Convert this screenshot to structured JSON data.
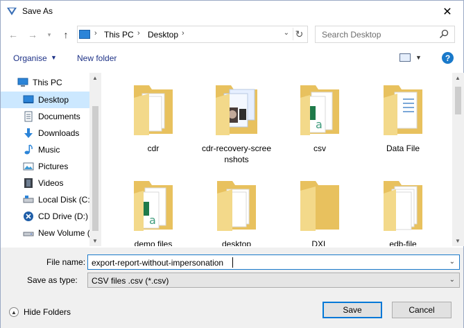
{
  "window": {
    "title": "Save As"
  },
  "address": {
    "crumbs": [
      "This PC",
      "Desktop"
    ]
  },
  "search": {
    "placeholder": "Search Desktop"
  },
  "toolbar": {
    "organise_label": "Organise",
    "new_folder_label": "New folder",
    "help_label": "?"
  },
  "sidebar": {
    "items": [
      {
        "label": "This PC",
        "icon": "computer-icon"
      },
      {
        "label": "Desktop",
        "icon": "desktop-icon"
      },
      {
        "label": "Documents",
        "icon": "documents-icon"
      },
      {
        "label": "Downloads",
        "icon": "downloads-icon"
      },
      {
        "label": "Music",
        "icon": "music-icon"
      },
      {
        "label": "Pictures",
        "icon": "pictures-icon"
      },
      {
        "label": "Videos",
        "icon": "videos-icon"
      },
      {
        "label": "Local Disk (C:)",
        "icon": "local-disk-icon"
      },
      {
        "label": "CD Drive (D:) X",
        "icon": "cd-drive-icon"
      },
      {
        "label": "New Volume (",
        "icon": "drive-icon"
      }
    ]
  },
  "files": [
    {
      "name": "cdr",
      "variant": "docs"
    },
    {
      "name": "cdr-recovery-screenshots",
      "name_line1": "cdr-recovery-scree",
      "name_line2": "nshots",
      "variant": "screens"
    },
    {
      "name": "csv",
      "variant": "green"
    },
    {
      "name": "Data File",
      "variant": "plain"
    },
    {
      "name": "demo files",
      "variant": "green"
    },
    {
      "name": "desktop",
      "variant": "docs"
    },
    {
      "name": "DXL",
      "variant": "empty"
    },
    {
      "name": "edb-file",
      "variant": "docs"
    }
  ],
  "form": {
    "file_name_label": "File name:",
    "file_name_value": "export-report-without-impersonation",
    "save_type_label": "Save as type:",
    "save_type_value": "CSV files .csv (*.csv)"
  },
  "footer": {
    "hide_folders_label": "Hide Folders",
    "save_label": "Save",
    "cancel_label": "Cancel"
  }
}
